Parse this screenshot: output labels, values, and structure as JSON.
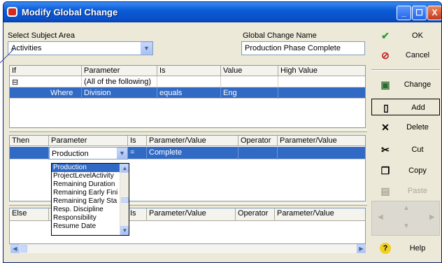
{
  "window": {
    "title": "Modify Global Change",
    "minimize": "_",
    "maximize": "☐",
    "close": "X"
  },
  "subject_area": {
    "label": "Select Subject Area",
    "value": "Activities"
  },
  "change_name": {
    "label": "Global Change Name",
    "value": "Production Phase Complete"
  },
  "if_grid": {
    "headers": [
      "If",
      "Parameter",
      "Is",
      "Value",
      "High Value"
    ],
    "rows": [
      {
        "if": "⊟",
        "parameter": "(All of the following)",
        "is": "",
        "value": "",
        "high": ""
      },
      {
        "if": "Where",
        "parameter": "Division",
        "is": "equals",
        "value": "Eng",
        "high": ""
      }
    ]
  },
  "then_grid": {
    "headers": [
      "Then",
      "Parameter",
      "Is",
      "Parameter/Value",
      "Operator",
      "Parameter/Value"
    ],
    "rows": [
      {
        "then": "",
        "parameter": "Production",
        "is": "=",
        "pv": "Complete",
        "op": "",
        "pv2": ""
      }
    ]
  },
  "dropdown_items": [
    "Production",
    "ProjectLevelActivity",
    "Remaining Duration",
    "Remaining Early Fini",
    "Remaining Early Sta",
    "Resp. Discipline",
    "Responsibility",
    "Resume Date"
  ],
  "else_grid": {
    "headers": [
      "Else",
      "",
      "Is",
      "Parameter/Value",
      "Operator",
      "Parameter/Value"
    ]
  },
  "buttons": {
    "ok": "OK",
    "cancel": "Cancel",
    "change": "Change",
    "add": "Add",
    "delete": "Delete",
    "cut": "Cut",
    "copy": "Copy",
    "paste": "Paste",
    "help": "Help"
  },
  "icons": {
    "ok": "✔",
    "cancel": "⊘",
    "change": "▣",
    "add": "▯",
    "delete": "✕",
    "cut": "✂",
    "copy": "❐",
    "paste": "▤",
    "help": "?"
  },
  "colors": {
    "title_bar": "#0b5bd6",
    "selection": "#316ac5",
    "ok_green": "#2f9e2f",
    "cancel_red": "#c02020"
  }
}
